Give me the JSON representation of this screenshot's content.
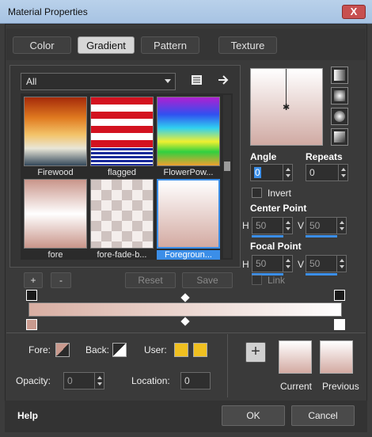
{
  "window": {
    "title": "Material Properties",
    "close_label": "X"
  },
  "tabs": [
    {
      "label": "Color"
    },
    {
      "label": "Gradient"
    },
    {
      "label": "Pattern"
    },
    {
      "label": "Texture"
    }
  ],
  "gradient_category": "All",
  "gradients": [
    {
      "name": "Firewood"
    },
    {
      "name": "flagged"
    },
    {
      "name": "FlowerPow..."
    },
    {
      "name": "fore"
    },
    {
      "name": "fore-fade-b..."
    },
    {
      "name": "Foregroun..."
    }
  ],
  "list_buttons": {
    "add": "+",
    "remove": "-",
    "reset": "Reset",
    "save": "Save"
  },
  "angle": {
    "label": "Angle",
    "value": "0"
  },
  "repeats": {
    "label": "Repeats",
    "value": "0"
  },
  "invert_label": "Invert",
  "center_point": {
    "label": "Center Point",
    "h_label": "H",
    "h_value": "50",
    "v_label": "V",
    "v_value": "50"
  },
  "focal_point": {
    "label": "Focal Point",
    "h_label": "H",
    "h_value": "50",
    "v_label": "V",
    "v_value": "50"
  },
  "link_label": "Link",
  "fore_label": "Fore:",
  "back_label": "Back:",
  "user_label": "User:",
  "opacity": {
    "label": "Opacity:",
    "value": "0"
  },
  "location": {
    "label": "Location:",
    "value": "0"
  },
  "add_swatch": "+",
  "current_label": "Current",
  "previous_label": "Previous",
  "help_label": "Help",
  "ok_label": "OK",
  "cancel_label": "Cancel",
  "colors": {
    "accent": "#3b8ee8",
    "user_color": "#f0c020",
    "gradient_start": "#d8aea2",
    "gradient_end": "#ffffff"
  }
}
